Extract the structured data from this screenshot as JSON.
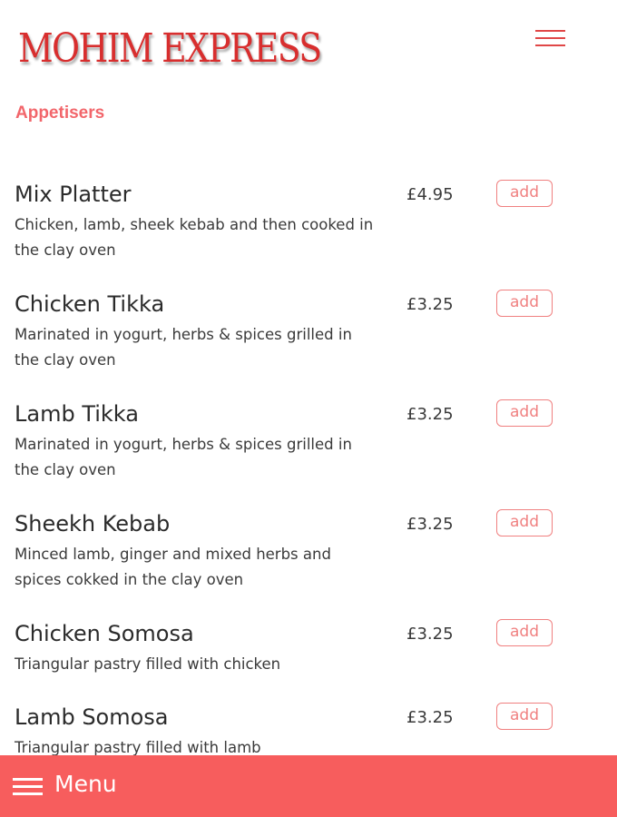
{
  "header": {
    "logo_text": "MOHIM EXPRESS",
    "menu_icon": "hamburger-icon"
  },
  "section": {
    "title": "Appetisers"
  },
  "items": [
    {
      "name": "Mix Platter",
      "description": "Chicken, lamb, sheek kebab and then cooked in the clay oven",
      "price": "£4.95",
      "add_label": "add"
    },
    {
      "name": "Chicken Tikka",
      "description": "Marinated in yogurt, herbs & spices grilled in the clay oven",
      "price": "£3.25",
      "add_label": "add"
    },
    {
      "name": "Lamb Tikka",
      "description": "Marinated in yogurt, herbs & spices grilled in the clay oven",
      "price": "£3.25",
      "add_label": "add"
    },
    {
      "name": "Sheekh Kebab",
      "description": "Minced lamb, ginger and mixed herbs and spices cokked in the clay oven",
      "price": "£3.25",
      "add_label": "add"
    },
    {
      "name": "Chicken Somosa",
      "description": "Triangular pastry filled with chicken",
      "price": "£3.25",
      "add_label": "add"
    },
    {
      "name": "Lamb Somosa",
      "description": "Triangular pastry filled with lamb",
      "price": "£3.25",
      "add_label": "add"
    }
  ],
  "footer": {
    "menu_label": "Menu",
    "menu_icon": "hamburger-icon"
  },
  "colors": {
    "accent": "#f75d5d",
    "logo": "#d82e2e",
    "section_title": "#f2666b",
    "add_button": "#f08080"
  }
}
